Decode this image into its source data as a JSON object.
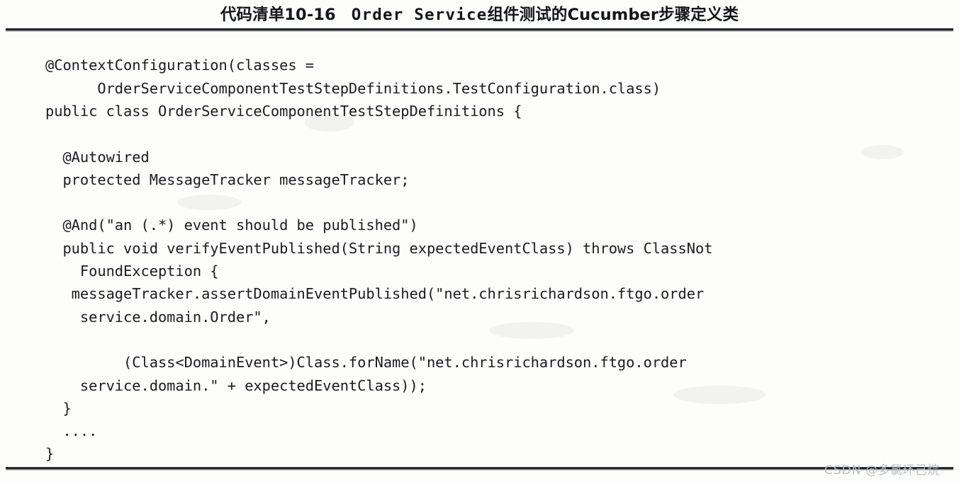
{
  "caption": {
    "prefix": "代码清单10-16",
    "mono_part": "Order Service",
    "suffix": "组件测试的Cucumber步骤定义类"
  },
  "code": {
    "language": "java",
    "lines": [
      "@ContextConfiguration(classes =",
      "      OrderServiceComponentTestStepDefinitions.TestConfiguration.class)",
      "public class OrderServiceComponentTestStepDefinitions {",
      "",
      "  @Autowired",
      "  protected MessageTracker messageTracker;",
      "",
      "  @And(\"an (.*) event should be published\")",
      "  public void verifyEventPublished(String expectedEventClass) throws ClassNot",
      "    FoundException {",
      "   messageTracker.assertDomainEventPublished(\"net.chrisrichardson.ftgo.order",
      "    service.domain.Order\",",
      "",
      "         (Class<DomainEvent>)Class.forName(\"net.chrisrichardson.ftgo.order",
      "    service.domain.\" + expectedEventClass));",
      "  }",
      "  ....",
      "}"
    ]
  },
  "watermark": {
    "brand": "CSDN",
    "handle": "@多氯环己烷"
  },
  "colors": {
    "page_background": "#fdfdfc",
    "rule": "#23252b",
    "code_text": "#1b1c20",
    "caption_text": "#15161a",
    "watermark_text": "#b9bcc2"
  }
}
